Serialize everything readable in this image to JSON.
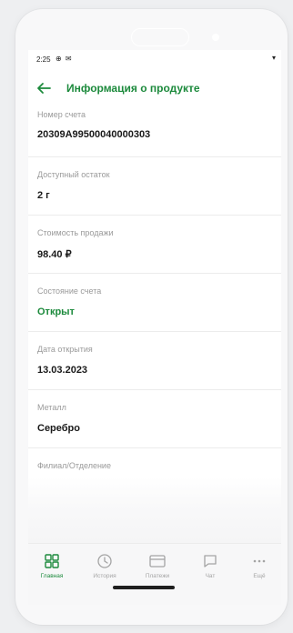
{
  "status_bar": {
    "time": "2:25",
    "icons": "⊕ ✉",
    "wifi": "▾"
  },
  "header": {
    "title": "Информация о продукте"
  },
  "fields": [
    {
      "label": "Номер счета",
      "value": "20309A99500040000303"
    },
    {
      "label": "Доступный остаток",
      "value": "2 г"
    },
    {
      "label": "Стоимость продажи",
      "value": "98.40 ₽"
    },
    {
      "label": "Состояние счета",
      "value": "Открыт"
    },
    {
      "label": "Дата открытия",
      "value": "13.03.2023"
    },
    {
      "label": "Металл",
      "value": "Серебро"
    },
    {
      "label": "Филиал/Отделение",
      "value": ""
    }
  ],
  "tabs": [
    {
      "label": "Главная",
      "icon": "grid-icon",
      "active": true
    },
    {
      "label": "История",
      "icon": "clock-icon",
      "active": false
    },
    {
      "label": "Платежи",
      "icon": "card-icon",
      "active": false
    },
    {
      "label": "Чат",
      "icon": "chat-icon",
      "active": false
    },
    {
      "label": "Ещё",
      "icon": "more-icon",
      "active": false
    }
  ],
  "colors": {
    "accent": "#1c8a3c",
    "label": "#9a9a9a",
    "background": "#eeeff1"
  }
}
